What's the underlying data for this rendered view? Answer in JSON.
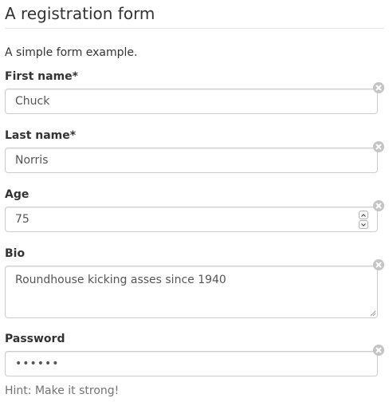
{
  "form": {
    "title": "A registration form",
    "description": "A simple form example.",
    "fields": {
      "first_name": {
        "label": "First name*",
        "value": "Chuck"
      },
      "last_name": {
        "label": "Last name*",
        "value": "Norris"
      },
      "age": {
        "label": "Age",
        "value": "75"
      },
      "bio": {
        "label": "Bio",
        "value": "Roundhouse kicking asses since 1940"
      },
      "password": {
        "label": "Password",
        "value": "••••••"
      }
    },
    "hint": "Hint: Make it strong!"
  },
  "colors": {
    "text": "#333333",
    "input_text": "#555555",
    "input_border": "#cccccc",
    "clear_icon": "#c4c4c4",
    "hint": "#737373"
  },
  "icons": {
    "clear": "clear-circle-x-icon",
    "spin_up": "chevron-up-icon",
    "spin_down": "chevron-down-icon",
    "resize": "resize-grip-icon"
  }
}
